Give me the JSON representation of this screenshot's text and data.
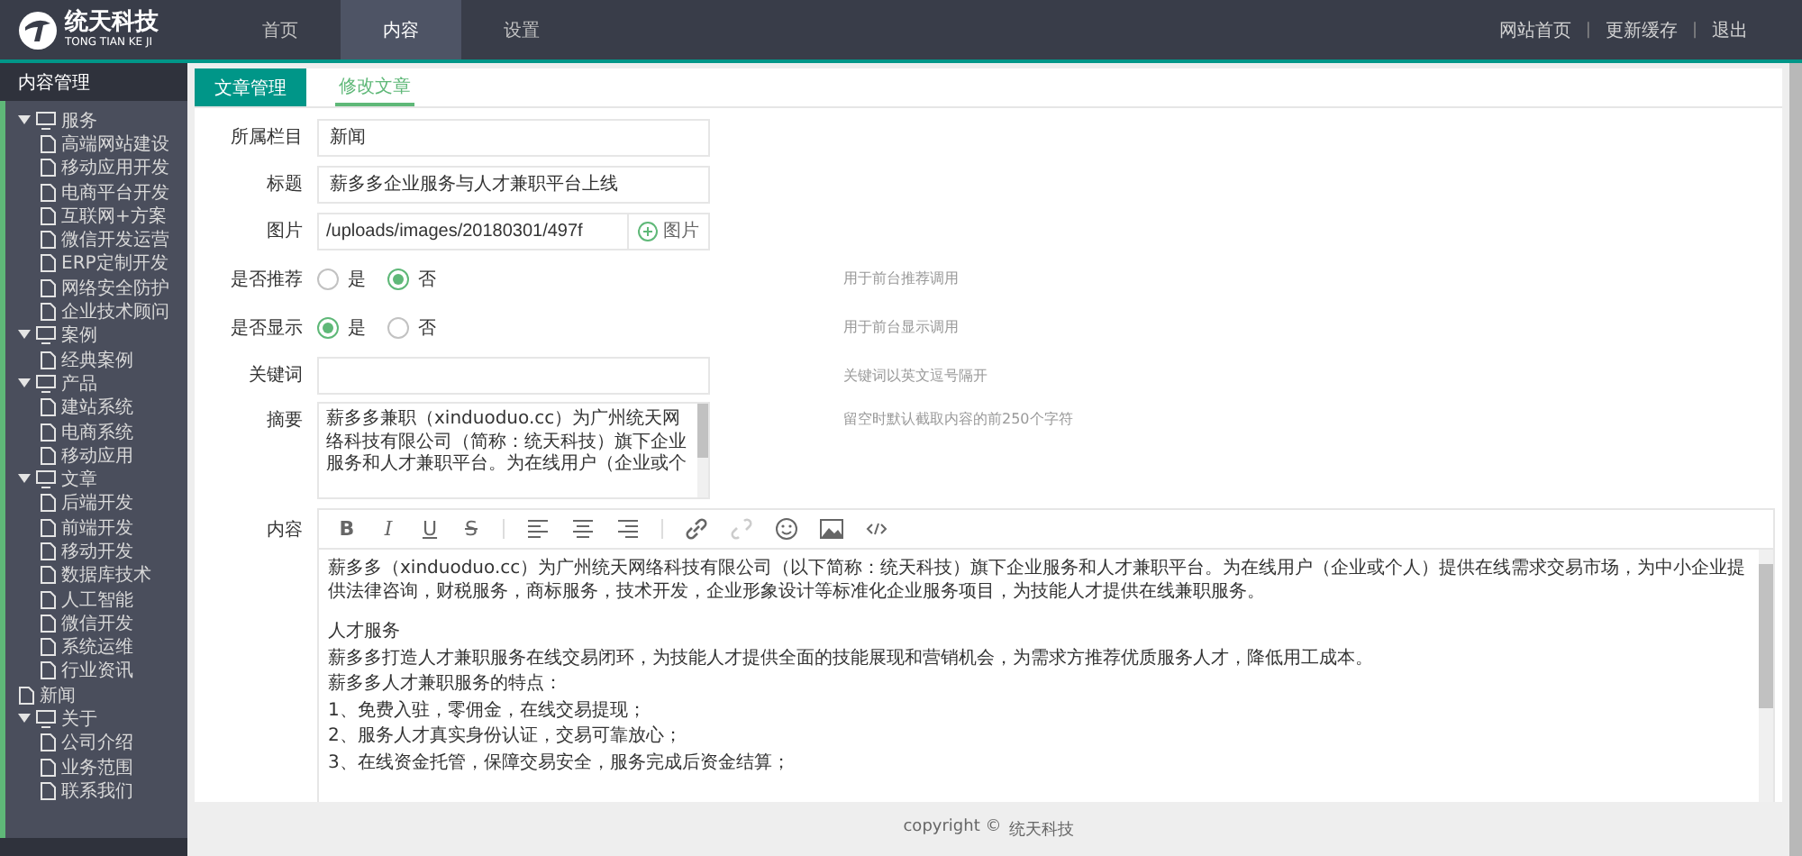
{
  "header": {
    "logo": {
      "name": "统天科技",
      "subtitle": "TONG TIAN KE JI"
    },
    "nav": [
      {
        "label": "首页",
        "selected": false
      },
      {
        "label": "内容",
        "selected": true
      },
      {
        "label": "设置",
        "selected": false
      }
    ],
    "links": [
      "网站首页",
      "|",
      "更新缓存",
      "|",
      "退出"
    ]
  },
  "sidebar": {
    "title": "内容管理",
    "tree": [
      {
        "label": "服务",
        "expanded": true,
        "children": [
          {
            "label": "高端网站建设"
          },
          {
            "label": "移动应用开发"
          },
          {
            "label": "电商平台开发"
          },
          {
            "label": "互联网+方案"
          },
          {
            "label": "微信开发运营"
          },
          {
            "label": "ERP定制开发"
          },
          {
            "label": "网络安全防护"
          },
          {
            "label": "企业技术顾问"
          }
        ]
      },
      {
        "label": "案例",
        "expanded": true,
        "children": [
          {
            "label": "经典案例"
          }
        ]
      },
      {
        "label": "产品",
        "expanded": true,
        "children": [
          {
            "label": "建站系统"
          },
          {
            "label": "电商系统"
          },
          {
            "label": "移动应用"
          }
        ]
      },
      {
        "label": "文章",
        "expanded": true,
        "children": [
          {
            "label": "后端开发"
          },
          {
            "label": "前端开发"
          },
          {
            "label": "移动开发"
          },
          {
            "label": "数据库技术"
          },
          {
            "label": "人工智能"
          },
          {
            "label": "微信开发"
          },
          {
            "label": "系统运维"
          },
          {
            "label": "行业资讯"
          }
        ]
      },
      {
        "label": "新闻"
      },
      {
        "label": "关于",
        "expanded": true,
        "children": [
          {
            "label": "公司介绍"
          },
          {
            "label": "业务范围"
          },
          {
            "label": "联系我们"
          }
        ]
      }
    ]
  },
  "tabs": [
    {
      "label": "文章管理",
      "selected": true
    },
    {
      "label": "修改文章",
      "selected": false
    }
  ],
  "form": [
    {
      "kind": "text",
      "label": "所属栏目",
      "value": "新闻"
    },
    {
      "kind": "text",
      "label": "标题",
      "value": "薪多多企业服务与人才兼职平台上线"
    },
    {
      "kind": "file",
      "label": "图片",
      "value": "/uploads/images/20180301/497f",
      "button": "图片"
    },
    {
      "kind": "radio",
      "label": "是否推荐",
      "options": [
        {
          "label": "是",
          "selected": false
        },
        {
          "label": "否",
          "selected": true
        }
      ],
      "hint": "用于前台推荐调用"
    },
    {
      "kind": "radio",
      "label": "是否显示",
      "options": [
        {
          "label": "是",
          "selected": true
        },
        {
          "label": "否",
          "selected": false
        }
      ],
      "hint": "用于前台显示调用"
    },
    {
      "kind": "text",
      "label": "关键词",
      "hint": "关键词以英文逗号隔开"
    },
    {
      "kind": "textarea",
      "label": "摘要",
      "value": "薪多多兼职（xinduoduo.cc）为广州统天网络科技有限公司（简称：统天科技）旗下企业服务和人才兼职平台。为在线用户（企业或个",
      "hint": "留空时默认截取内容的前250个字符"
    }
  ],
  "editor": {
    "label": "内容",
    "toolbar": [
      {
        "kind": "bold",
        "label": "B"
      },
      {
        "kind": "italic",
        "label": "I"
      },
      {
        "kind": "underline",
        "label": "U"
      },
      {
        "kind": "strike",
        "label": "S"
      },
      {
        "kind": "sep"
      },
      {
        "kind": "align-left"
      },
      {
        "kind": "align-center"
      },
      {
        "kind": "align-right"
      },
      {
        "kind": "sep"
      },
      {
        "kind": "link"
      },
      {
        "kind": "unlink"
      },
      {
        "kind": "emoji"
      },
      {
        "kind": "image"
      },
      {
        "kind": "code"
      }
    ],
    "paragraphs": [
      {
        "kind": "text",
        "text": "薪多多（xinduoduo.cc）为广州统天网络科技有限公司（以下简称：统天科技）旗下企业服务和人才兼职平台。为在线用户（企业或个人）提供在线需求交易市场，为中小企业提供法律咨询，财税服务，商标服务，技术开发，企业形象设计等标准化企业服务项目，为技能人才提供在线兼职服务。"
      },
      {
        "kind": "blank"
      },
      {
        "kind": "text",
        "text": "人才服务"
      },
      {
        "kind": "text",
        "text": "薪多多打造人才兼职服务在线交易闭环，为技能人才提供全面的技能展现和营销机会，为需求方推荐优质服务人才，降低用工成本。"
      },
      {
        "kind": "text",
        "text": "薪多多人才兼职服务的特点："
      },
      {
        "kind": "text",
        "text": "1、免费入驻，零佣金，在线交易提现；"
      },
      {
        "kind": "text",
        "text": "2、服务人才真实身份认证，交易可靠放心；"
      },
      {
        "kind": "text",
        "text": "3、在线资金托管，保障交易安全，服务完成后资金结算；"
      }
    ]
  },
  "footer": {
    "copyright": "copyright ©",
    "company": "统天科技"
  }
}
